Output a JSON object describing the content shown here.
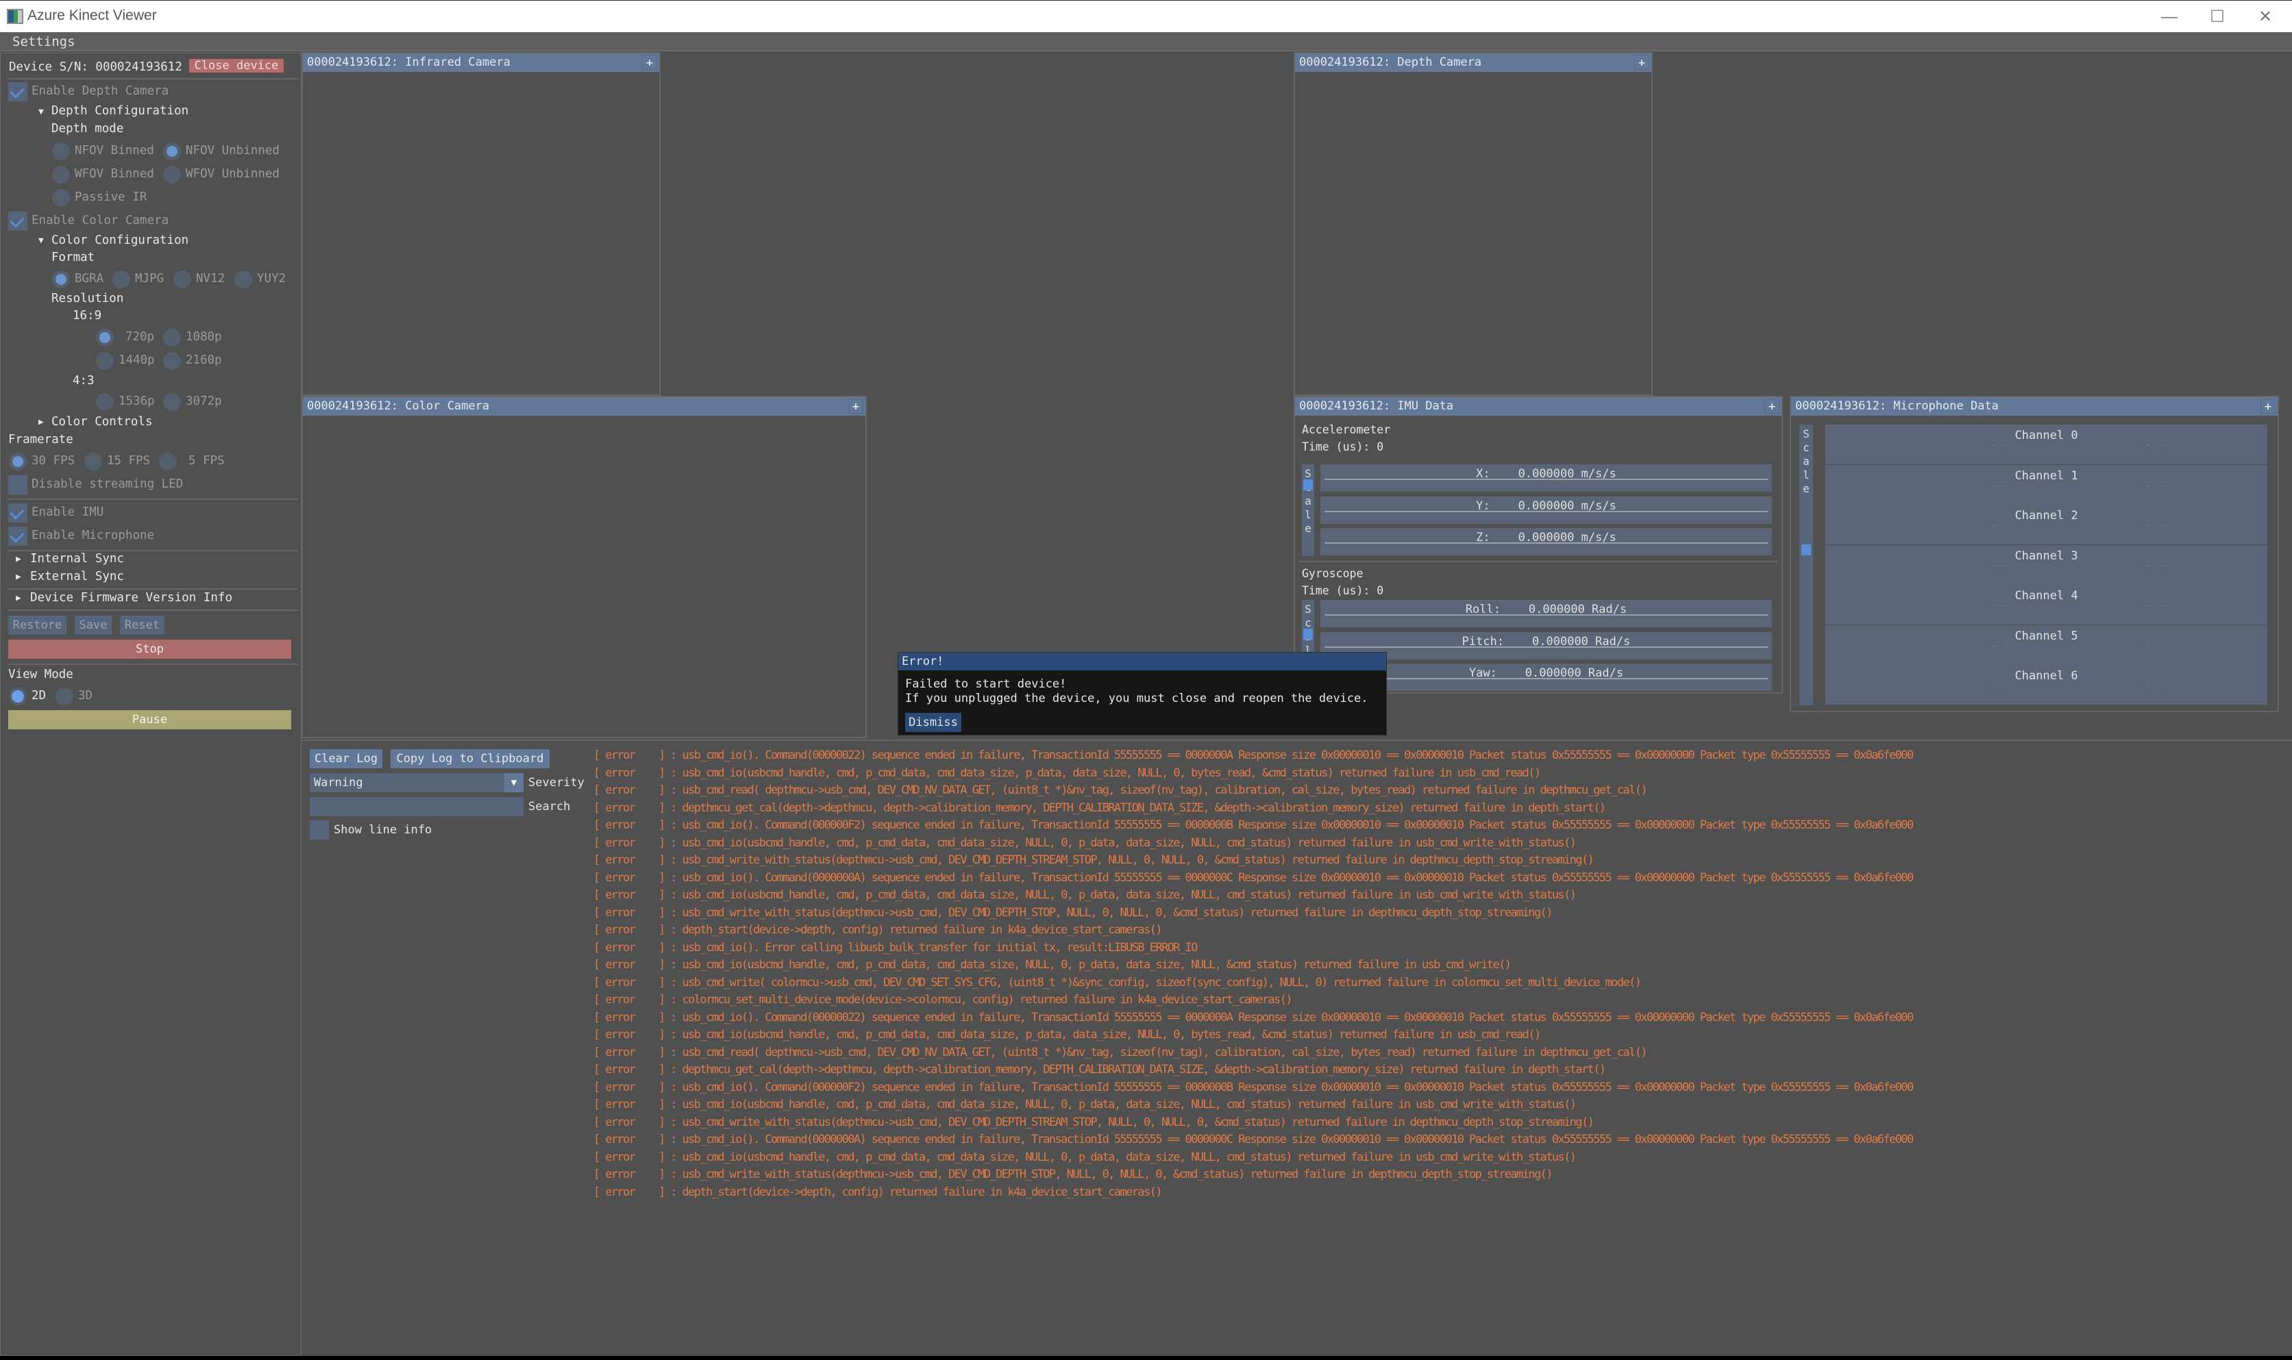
{
  "window": {
    "title": "Azure Kinect Viewer",
    "controls": {
      "minimize": "—",
      "maximize": "☐",
      "close": "✕"
    }
  },
  "menubar": {
    "settings": "Settings"
  },
  "sidebar": {
    "device_sn_label": "Device S/N: 000024193612",
    "close_device": "Close device",
    "enable_depth": {
      "label": "Enable Depth Camera",
      "checked": true
    },
    "depth_config": {
      "header": "Depth Configuration",
      "mode_label": "Depth mode",
      "modes": [
        {
          "label": "NFOV Binned",
          "selected": false
        },
        {
          "label": "NFOV Unbinned",
          "selected": true
        },
        {
          "label": "WFOV Binned",
          "selected": false
        },
        {
          "label": "WFOV Unbinned",
          "selected": false
        },
        {
          "label": "Passive IR",
          "selected": false
        }
      ]
    },
    "enable_color": {
      "label": "Enable Color Camera",
      "checked": true
    },
    "color_config": {
      "header": "Color Configuration",
      "format_label": "Format",
      "formats": [
        {
          "label": "BGRA",
          "selected": true
        },
        {
          "label": "MJPG",
          "selected": false
        },
        {
          "label": "NV12",
          "selected": false
        },
        {
          "label": "YUY2",
          "selected": false
        }
      ],
      "resolution_label": "Resolution",
      "aspect_16_9": "16:9",
      "res_16_9": [
        {
          "label": "720p",
          "selected": true
        },
        {
          "label": "1080p",
          "selected": false
        },
        {
          "label": "1440p",
          "selected": false
        },
        {
          "label": "2160p",
          "selected": false
        }
      ],
      "aspect_4_3": "4:3",
      "res_4_3": [
        {
          "label": "1536p",
          "selected": false
        },
        {
          "label": "3072p",
          "selected": false
        }
      ],
      "color_controls": "Color Controls"
    },
    "framerate_label": "Framerate",
    "framerates": [
      {
        "label": "30 FPS",
        "selected": true
      },
      {
        "label": "15 FPS",
        "selected": false
      },
      {
        "label": "5 FPS",
        "selected": false
      }
    ],
    "disable_led": {
      "label": "Disable streaming LED",
      "checked": false
    },
    "enable_imu": {
      "label": "Enable IMU",
      "checked": true
    },
    "enable_mic": {
      "label": "Enable Microphone",
      "checked": true
    },
    "internal_sync": "Internal Sync",
    "external_sync": "External Sync",
    "firmware_info": "Device Firmware Version Info",
    "restore": "Restore",
    "save": "Save",
    "reset": "Reset",
    "stop": "Stop",
    "view_mode_label": "View Mode",
    "view_modes": [
      {
        "label": "2D",
        "selected": true
      },
      {
        "label": "3D",
        "selected": false
      }
    ],
    "pause": "Pause"
  },
  "panels": {
    "infrared": {
      "title": "000024193612: Infrared Camera",
      "expand": "+"
    },
    "depth": {
      "title": "000024193612: Depth Camera",
      "expand": "+"
    },
    "color": {
      "title": "000024193612: Color Camera",
      "expand": "+"
    },
    "imu": {
      "title": "000024193612: IMU Data",
      "expand": "+",
      "scale_label": "Scale",
      "accelerometer": {
        "label": "Accelerometer",
        "time": "Time (us): 0",
        "axes": [
          {
            "name": "X:",
            "value": "0.000000 m/s/s"
          },
          {
            "name": "Y:",
            "value": "0.000000 m/s/s"
          },
          {
            "name": "Z:",
            "value": "0.000000 m/s/s"
          }
        ]
      },
      "gyroscope": {
        "label": "Gyroscope",
        "time": "Time (us): 0",
        "axes": [
          {
            "name": "Roll:",
            "value": "0.000000 Rad/s"
          },
          {
            "name": "Pitch:",
            "value": "0.000000 Rad/s"
          },
          {
            "name": "Yaw:",
            "value": "0.000000 Rad/s"
          }
        ]
      }
    },
    "microphone": {
      "title": "000024193612: Microphone Data",
      "expand": "+",
      "scale_label": "Scale",
      "channels": [
        "Channel 0",
        "Channel 1",
        "Channel 2",
        "Channel 3",
        "Channel 4",
        "Channel 5",
        "Channel 6"
      ]
    }
  },
  "error_dialog": {
    "title": "Error!",
    "line1": "Failed to start device!",
    "line2": "If you unplugged the device, you must close and reopen the device.",
    "dismiss": "Dismiss"
  },
  "log": {
    "clear": "Clear Log",
    "copy": "Copy Log to Clipboard",
    "severity_value": "Warning",
    "severity_label": "Severity",
    "search_value": "",
    "search_label": "Search",
    "show_line_info": {
      "label": "Show line info",
      "checked": false
    },
    "error_color": "#e07a47",
    "lines": [
      "[ error    ] : usb_cmd_io(). Command(00000022) sequence ended in failure, TransactionId 55555555 == 0000000A Response size 0x00000010 == 0x00000010 Packet status 0x55555555 == 0x00000000 Packet type 0x55555555 == 0x0a6fe000",
      "[ error    ] : usb_cmd_io(usbcmd_handle, cmd, p_cmd_data, cmd_data_size, p_data, data_size, NULL, 0, bytes_read, &cmd_status) returned failure in usb_cmd_read()",
      "[ error    ] : usb_cmd_read( depthmcu->usb_cmd, DEV_CMD_NV_DATA_GET, (uint8_t *)&nv_tag, sizeof(nv_tag), calibration, cal_size, bytes_read) returned failure in depthmcu_get_cal()",
      "[ error    ] : depthmcu_get_cal(depth->depthmcu, depth->calibration_memory, DEPTH_CALIBRATION_DATA_SIZE, &depth->calibration_memory_size) returned failure in depth_start()",
      "[ error    ] : usb_cmd_io(). Command(000000F2) sequence ended in failure, TransactionId 55555555 == 0000000B Response size 0x00000010 == 0x00000010 Packet status 0x55555555 == 0x00000000 Packet type 0x55555555 == 0x0a6fe000",
      "[ error    ] : usb_cmd_io(usbcmd_handle, cmd, p_cmd_data, cmd_data_size, NULL, 0, p_data, data_size, NULL, cmd_status) returned failure in usb_cmd_write_with_status()",
      "[ error    ] : usb_cmd_write_with_status(depthmcu->usb_cmd, DEV_CMD_DEPTH_STREAM_STOP, NULL, 0, NULL, 0, &cmd_status) returned failure in depthmcu_depth_stop_streaming()",
      "[ error    ] : usb_cmd_io(). Command(0000000A) sequence ended in failure, TransactionId 55555555 == 0000000C Response size 0x00000010 == 0x00000010 Packet status 0x55555555 == 0x00000000 Packet type 0x55555555 == 0x0a6fe000",
      "[ error    ] : usb_cmd_io(usbcmd_handle, cmd, p_cmd_data, cmd_data_size, NULL, 0, p_data, data_size, NULL, cmd_status) returned failure in usb_cmd_write_with_status()",
      "[ error    ] : usb_cmd_write_with_status(depthmcu->usb_cmd, DEV_CMD_DEPTH_STOP, NULL, 0, NULL, 0, &cmd_status) returned failure in depthmcu_depth_stop_streaming()",
      "[ error    ] : depth_start(device->depth, config) returned failure in k4a_device_start_cameras()",
      "[ error    ] : usb_cmd_io(). Error calling libusb_bulk_transfer for initial tx, result:LIBUSB_ERROR_IO",
      "[ error    ] : usb_cmd_io(usbcmd_handle, cmd, p_cmd_data, cmd_data_size, NULL, 0, p_data, data_size, NULL, &cmd_status) returned failure in usb_cmd_write()",
      "[ error    ] : usb_cmd_write( colormcu->usb_cmd, DEV_CMD_SET_SYS_CFG, (uint8_t *)&sync_config, sizeof(sync_config), NULL, 0) returned failure in colormcu_set_multi_device_mode()",
      "[ error    ] : colormcu_set_multi_device_mode(device->colormcu, config) returned failure in k4a_device_start_cameras()",
      "[ error    ] : usb_cmd_io(). Command(00000022) sequence ended in failure, TransactionId 55555555 == 0000000A Response size 0x00000010 == 0x00000010 Packet status 0x55555555 == 0x00000000 Packet type 0x55555555 == 0x0a6fe000",
      "[ error    ] : usb_cmd_io(usbcmd_handle, cmd, p_cmd_data, cmd_data_size, p_data, data_size, NULL, 0, bytes_read, &cmd_status) returned failure in usb_cmd_read()",
      "[ error    ] : usb_cmd_read( depthmcu->usb_cmd, DEV_CMD_NV_DATA_GET, (uint8_t *)&nv_tag, sizeof(nv_tag), calibration, cal_size, bytes_read) returned failure in depthmcu_get_cal()",
      "[ error    ] : depthmcu_get_cal(depth->depthmcu, depth->calibration_memory, DEPTH_CALIBRATION_DATA_SIZE, &depth->calibration_memory_size) returned failure in depth_start()",
      "[ error    ] : usb_cmd_io(). Command(000000F2) sequence ended in failure, TransactionId 55555555 == 0000000B Response size 0x00000010 == 0x00000010 Packet status 0x55555555 == 0x00000000 Packet type 0x55555555 == 0x0a6fe000",
      "[ error    ] : usb_cmd_io(usbcmd_handle, cmd, p_cmd_data, cmd_data_size, NULL, 0, p_data, data_size, NULL, cmd_status) returned failure in usb_cmd_write_with_status()",
      "[ error    ] : usb_cmd_write_with_status(depthmcu->usb_cmd, DEV_CMD_DEPTH_STREAM_STOP, NULL, 0, NULL, 0, &cmd_status) returned failure in depthmcu_depth_stop_streaming()",
      "[ error    ] : usb_cmd_io(). Command(0000000A) sequence ended in failure, TransactionId 55555555 == 0000000C Response size 0x00000010 == 0x00000010 Packet status 0x55555555 == 0x00000000 Packet type 0x55555555 == 0x0a6fe000",
      "[ error    ] : usb_cmd_io(usbcmd_handle, cmd, p_cmd_data, cmd_data_size, NULL, 0, p_data, data_size, NULL, cmd_status) returned failure in usb_cmd_write_with_status()",
      "[ error    ] : usb_cmd_write_with_status(depthmcu->usb_cmd, DEV_CMD_DEPTH_STOP, NULL, 0, NULL, 0, &cmd_status) returned failure in depthmcu_depth_stop_streaming()",
      "[ error    ] : depth_start(device->depth, config) returned failure in k4a_device_start_cameras()"
    ]
  }
}
